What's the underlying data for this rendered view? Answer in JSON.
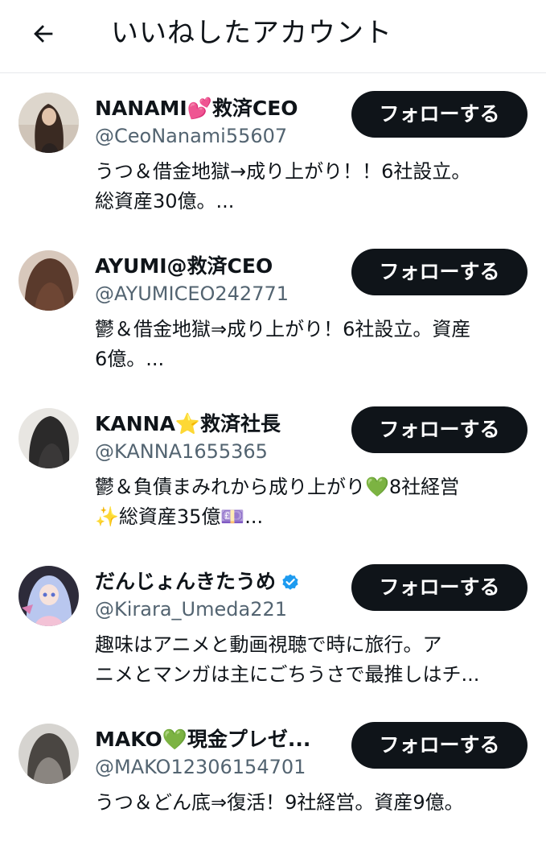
{
  "header": {
    "title": "いいねしたアカウント",
    "back_icon": "arrow-left-icon"
  },
  "colors": {
    "text": "#0f1419",
    "secondary": "#536471",
    "button_bg": "#0f1419",
    "button_text": "#ffffff",
    "verified": "#1d9bf0"
  },
  "accounts": [
    {
      "name": "NANAMI💕救済CEO",
      "handle": "@CeoNanami55607",
      "bio": "うつ＆借金地獄→成り上がり！！6社設立。\n総資産30億。...",
      "follow_label": "フォローする",
      "verified": false
    },
    {
      "name": "AYUMI@救済CEO",
      "handle": "@AYUMICEO242771",
      "bio": "鬱＆借金地獄⇒成り上がり！6社設立。資産\n6億。...",
      "follow_label": "フォローする",
      "verified": false
    },
    {
      "name": "KANNA⭐救済社長",
      "handle": "@KANNA1655365",
      "bio": "鬱＆負債まみれから成り上がり💚8社経営\n✨総資産35億💷...",
      "follow_label": "フォローする",
      "verified": false
    },
    {
      "name": "だんじょんきたうめ",
      "handle": "@Kirara_Umeda221",
      "bio": "趣味はアニメと動画視聴で時に旅行。ア\nニメとマンガは主にごちうさで最推しはチ...",
      "follow_label": "フォローする",
      "verified": true
    },
    {
      "name": "MAKO💚現金プレゼ...",
      "handle": "@MAKO12306154701",
      "bio": "うつ＆どん底⇒復活！9社経営。資産9億。",
      "follow_label": "フォローする",
      "verified": false
    }
  ]
}
